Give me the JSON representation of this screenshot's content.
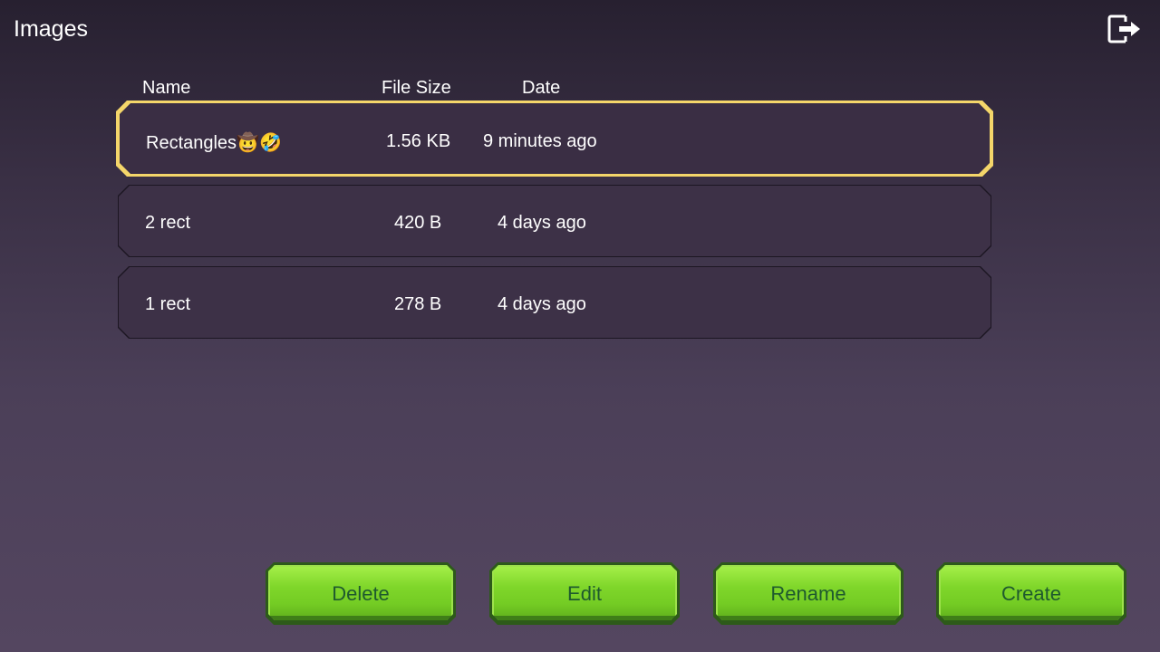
{
  "header": {
    "title": "Images",
    "exit_icon": "exit-icon"
  },
  "columns": {
    "name": "Name",
    "size": "File Size",
    "date": "Date"
  },
  "rows": [
    {
      "name": "Rectangles🤠🤣",
      "size": "1.56 KB",
      "date": "9 minutes ago",
      "selected": true
    },
    {
      "name": "2 rect",
      "size": "420 B",
      "date": "4 days ago",
      "selected": false
    },
    {
      "name": "1 rect",
      "size": "278 B",
      "date": "4 days ago",
      "selected": false
    }
  ],
  "buttons": {
    "delete": "Delete",
    "edit": "Edit",
    "rename": "Rename",
    "create": "Create"
  },
  "colors": {
    "selection_border": "#f4d66a",
    "button_green": "#7fd62a",
    "button_text": "#1f5a2e"
  }
}
